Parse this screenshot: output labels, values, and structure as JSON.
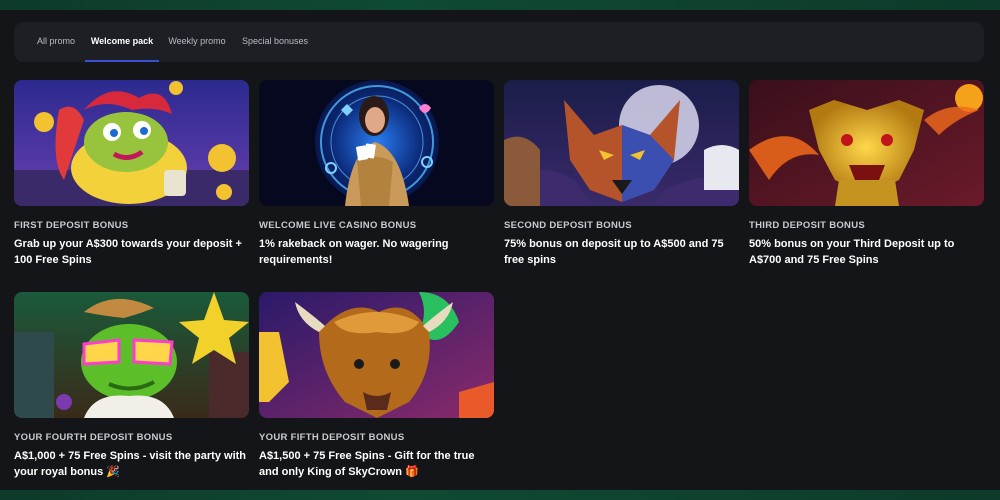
{
  "tabs": [
    {
      "label": "All promo",
      "active": false
    },
    {
      "label": "Welcome pack",
      "active": true
    },
    {
      "label": "Weekly promo",
      "active": false
    },
    {
      "label": "Special bonuses",
      "active": false
    }
  ],
  "promos": [
    {
      "category": "FIRST DEPOSIT BONUS",
      "text": "Grab up your A$300 towards your deposit + 100 Free Spins",
      "image": "frog-coins-illustration"
    },
    {
      "category": "WELCOME LIVE CASINO BONUS",
      "text": "1% rakeback on wager. No wagering requirements!",
      "image": "live-dealer-illustration"
    },
    {
      "category": "SECOND DEPOSIT BONUS",
      "text": "75% bonus on deposit up to A$500 and 75 free spins",
      "image": "wolf-illustration"
    },
    {
      "category": "THIRD DEPOSIT BONUS",
      "text": "50% bonus on your Third Deposit up to A$700 and 75 Free Spins",
      "image": "golden-dragon-illustration"
    },
    {
      "category": "YOUR FOURTH DEPOSIT BONUS",
      "text": "A$1,000 + 75 Free Spins - visit the party with your royal bonus 🎉",
      "image": "elvis-frog-illustration"
    },
    {
      "category": "YOUR FIFTH DEPOSIT BONUS",
      "text": "A$1,500 + 75 Free Spins - Gift for the true and only King of SkyCrown 🎁",
      "image": "buffalo-illustration"
    }
  ],
  "colors": {
    "background": "#141519",
    "tabbar": "#1e1f25",
    "active_tab_underline": "#3a4ed6",
    "accent_green": "#0f4a33"
  }
}
